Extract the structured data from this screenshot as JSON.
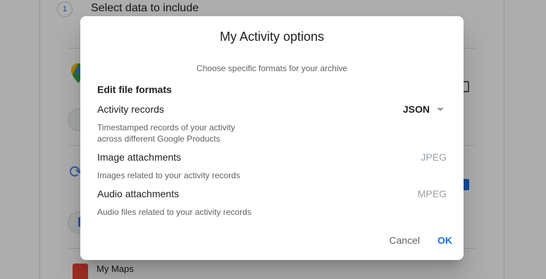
{
  "background": {
    "step_number": "1",
    "step_title": "Select data to include",
    "product_item": "My Maps"
  },
  "dialog": {
    "title": "My Activity options",
    "subtitle": "Choose specific formats for your archive",
    "section_heading": "Edit file formats",
    "rows": [
      {
        "label": "Activity records",
        "description": [
          "Timestamped records of your activity",
          "across different Google Products"
        ],
        "value": "JSON",
        "editable": true
      },
      {
        "label": "Image attachments",
        "description": [
          "Images related to your activity records"
        ],
        "value": "JPEG",
        "editable": false
      },
      {
        "label": "Audio attachments",
        "description": [
          "Audio files related to your activity records"
        ],
        "value": "MPEG",
        "editable": false
      }
    ],
    "buttons": {
      "cancel": "Cancel",
      "ok": "OK"
    }
  },
  "colors": {
    "accent": "#1a73e8",
    "scrim": "rgba(0,0,0,0.32)"
  }
}
